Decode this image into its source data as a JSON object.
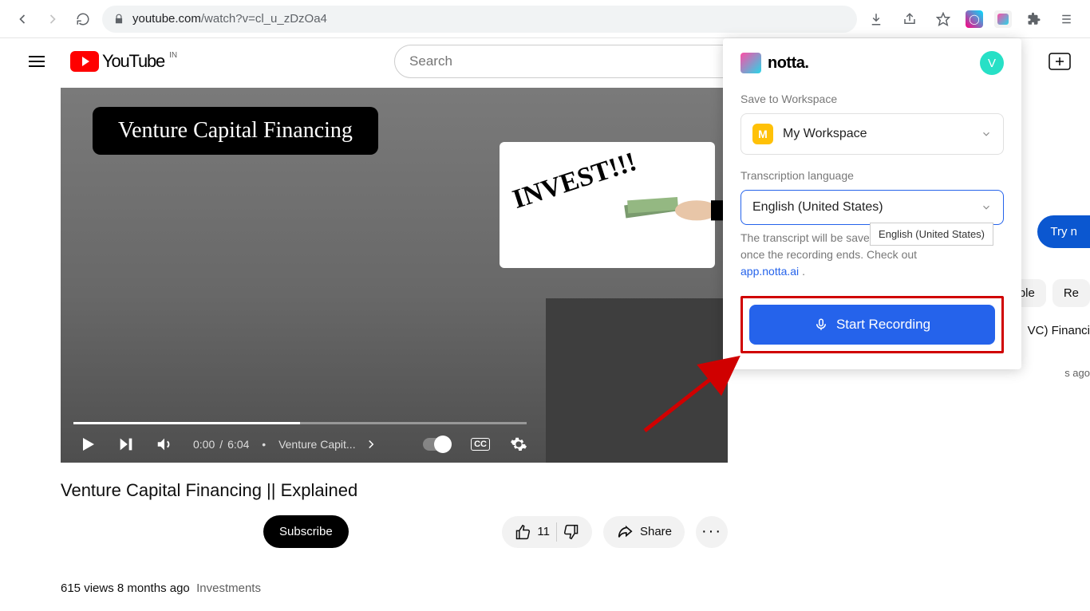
{
  "browser": {
    "url_host": "youtube.com",
    "url_path": "/watch?v=cl_u_zDzOa4"
  },
  "youtube": {
    "logo_text": "YouTube",
    "region": "IN",
    "search_placeholder": "Search",
    "video_overlay_title": "Venture Capital Financing",
    "invest_card_text": "INVEST!!!",
    "player": {
      "current_time": "0:00",
      "duration": "6:04",
      "chapter_label": "Venture Capit...",
      "separator": "•"
    },
    "video_title": "Venture Capital Financing || Explained",
    "subscribe_label": "Subscribe",
    "like_count": "11",
    "share_label": "Share",
    "description_line": "615 views  8 months ago",
    "description_tag": "Investments",
    "sidebar": {
      "chip1": "able",
      "chip2": "Re",
      "try_label": "Try n",
      "rec_title": "VC) Financi",
      "rec_time": "s ago"
    }
  },
  "popup": {
    "brand": "notta.",
    "avatar_initial": "V",
    "workspace_label": "Save to Workspace",
    "workspace_value": "My Workspace",
    "workspace_badge": "M",
    "lang_label": "Transcription language",
    "lang_value": "English (United States)",
    "lang_tooltip": "English (United States)",
    "info_text_1": "The transcript will be saved to your Notta account once the recording ends. Check out",
    "info_link_text": "app.notta.ai",
    "info_dot": ".",
    "record_label": "Start Recording"
  }
}
